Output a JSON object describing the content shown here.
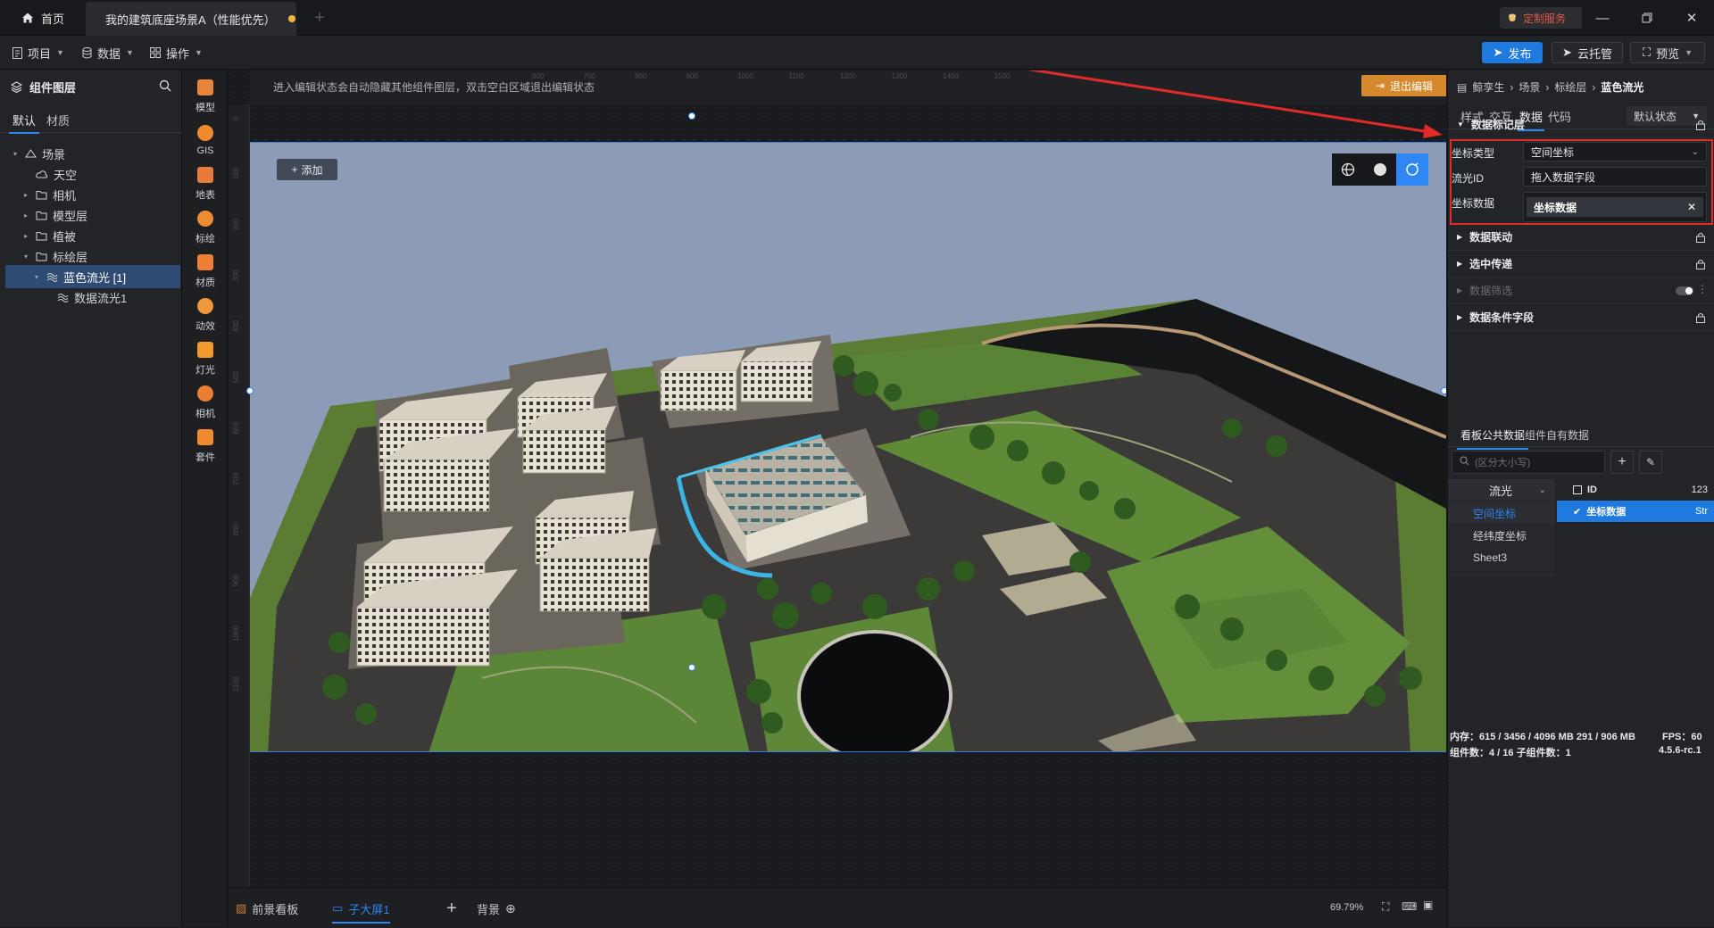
{
  "titlebar": {
    "home_tab": "首页",
    "doc_tab": "我的建筑底座场景A（性能优先）",
    "service_label": "定制服务"
  },
  "menubar": {
    "project": "项目",
    "data": "数据",
    "operate": "操作",
    "publish": "发布",
    "cloud_host": "云托管",
    "preview": "预览"
  },
  "layers": {
    "title": "组件图层",
    "tabs": [
      "默认",
      "材质"
    ],
    "tree": [
      {
        "label": "场景",
        "level": 0,
        "arrow": "▾",
        "icon": "scene-icon"
      },
      {
        "label": "天空",
        "level": 1,
        "arrow": "",
        "icon": "sky-icon"
      },
      {
        "label": "相机",
        "level": 1,
        "arrow": "▸",
        "icon": "folder-icon"
      },
      {
        "label": "模型层",
        "level": 1,
        "arrow": "▸",
        "icon": "folder-icon"
      },
      {
        "label": "植被",
        "level": 1,
        "arrow": "▸",
        "icon": "folder-icon"
      },
      {
        "label": "标绘层",
        "level": 1,
        "arrow": "▾",
        "icon": "folder-icon"
      },
      {
        "label": "蓝色流光 [1]",
        "level": 2,
        "arrow": "▾",
        "icon": "flow-icon",
        "selected": true
      },
      {
        "label": "数据流光1",
        "level": 3,
        "arrow": "",
        "icon": "flow-icon"
      }
    ]
  },
  "strip": [
    {
      "label": "模型",
      "icon": "model-icon",
      "color": "#e9853a"
    },
    {
      "label": "GIS",
      "icon": "gis-icon",
      "color": "#f08a2b"
    },
    {
      "label": "地表",
      "icon": "terrain-icon",
      "color": "#e97b3a"
    },
    {
      "label": "标绘",
      "icon": "marker-icon",
      "color": "#ef8c33"
    },
    {
      "label": "材质",
      "icon": "material-icon",
      "color": "#ee7f34"
    },
    {
      "label": "动效",
      "icon": "effect-icon",
      "color": "#f0983a"
    },
    {
      "label": "灯光",
      "icon": "light-icon",
      "color": "#f29a2c"
    },
    {
      "label": "相机",
      "icon": "camera-icon",
      "color": "#ec7d33"
    },
    {
      "label": "套件",
      "icon": "kit-icon",
      "color": "#ef8a30"
    }
  ],
  "canvas": {
    "hint": "进入编辑状态会自动隐藏其他组件图层，双击空白区域退出编辑状态",
    "exit_edit": "退出编辑",
    "add": "添加",
    "ruler_top": [
      "600",
      "700",
      "800",
      "900",
      "1000",
      "1100",
      "1200",
      "1300",
      "1400",
      "1500"
    ],
    "ruler_left": [
      "0",
      "100",
      "200",
      "300",
      "400",
      "500",
      "600",
      "700",
      "800",
      "900",
      "1000",
      "1100"
    ]
  },
  "bottombar": {
    "foreground": "前景看板",
    "sub_screen": "子大屏1",
    "background": "背景",
    "zoom": "69.79%"
  },
  "inspector": {
    "breadcrumb": [
      "鲸孪生",
      "场景",
      "标绘层",
      "蓝色流光"
    ],
    "tabs": [
      "样式",
      "交互",
      "数据",
      "代码"
    ],
    "state": "默认状态",
    "sections": {
      "mark_layer": "数据标记层",
      "linkage": "数据联动",
      "selected_pass": "选中传递",
      "filter": "数据筛选",
      "condition": "数据条件字段"
    },
    "fields": {
      "coord_type_label": "坐标类型",
      "coord_type_value": "空间坐标",
      "flow_id_label": "流光ID",
      "flow_id_placeholder": "拖入数据字段",
      "coord_data_label": "坐标数据",
      "coord_data_chip": "坐标数据"
    },
    "dataset_tabs": [
      "看板公共数据",
      "组件自有数据"
    ],
    "search_placeholder": "(区分大小写)",
    "source": {
      "selected": "流光",
      "items": [
        "空间坐标",
        "经纬度坐标",
        "Sheet3"
      ]
    },
    "field_list": [
      {
        "name": "ID",
        "type": "123"
      },
      {
        "name": "坐标数据",
        "type": "Str"
      }
    ],
    "status": {
      "memory": "内存：615 / 3456 / 4096 MB   291 / 906 MB",
      "fps": "FPS：60",
      "components": "组件数：4 / 16   子组件数：1",
      "version": "4.5.6-rc.1"
    }
  },
  "colors": {
    "accent": "#2f86f5",
    "highlight_box": "#e22a2a",
    "exit_button": "#d5892c"
  }
}
